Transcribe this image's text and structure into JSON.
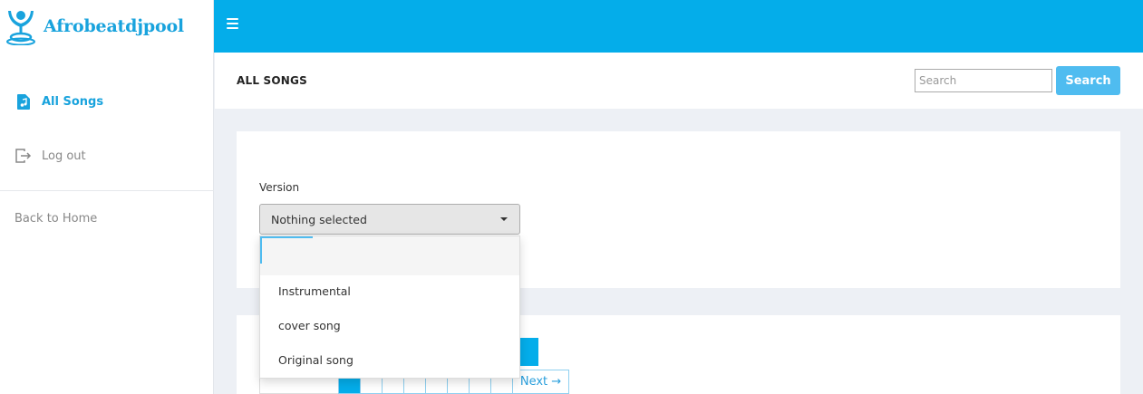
{
  "app": {
    "logo_text": "Afrobeatdjpool"
  },
  "sidebar": {
    "items": [
      {
        "label": "All Songs",
        "icon": "music-file-icon",
        "active": true
      },
      {
        "label": "Log out",
        "icon": "logout-icon",
        "active": false
      }
    ],
    "back_home": "Back to Home"
  },
  "topbar": {
    "menu_icon": "hamburger-icon",
    "color": "#04adea"
  },
  "page": {
    "title": "ALL SONGS",
    "search": {
      "placeholder": "Search",
      "value": "",
      "button_label": "Search"
    }
  },
  "filter": {
    "version_label": "Version",
    "selected_text": "Nothing selected",
    "options": [
      {
        "label": "Instrumental"
      },
      {
        "label": "cover song"
      },
      {
        "label": "Original song"
      }
    ]
  },
  "pagination": {
    "next_label": "Next →"
  },
  "colors": {
    "accent": "#04adea",
    "active_text": "#19a3dd",
    "button": "#4fbcf0"
  }
}
